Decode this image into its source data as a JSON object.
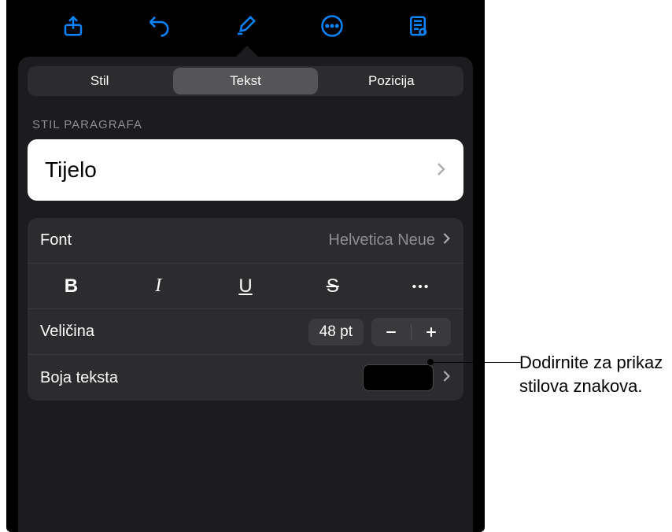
{
  "toolbar": {
    "icons": [
      "share",
      "undo",
      "format-brush",
      "more",
      "view-mode"
    ]
  },
  "tabs": {
    "style": "Stil",
    "text": "Tekst",
    "position": "Pozicija",
    "selected": "text"
  },
  "section": {
    "paragraph_style_label": "STIL PARAGRAFA"
  },
  "paragraph_style": {
    "value": "Tijelo"
  },
  "font": {
    "label": "Font",
    "value": "Helvetica Neue"
  },
  "styles": {
    "bold": "B",
    "italic": "I",
    "underline": "U",
    "strike": "S",
    "more": "more-icon"
  },
  "size": {
    "label": "Veličina",
    "value": "48 pt"
  },
  "color": {
    "label": "Boja teksta",
    "value": "#000000"
  },
  "annotation": {
    "text": "Dodirnite za prikaz stilova znakova."
  }
}
